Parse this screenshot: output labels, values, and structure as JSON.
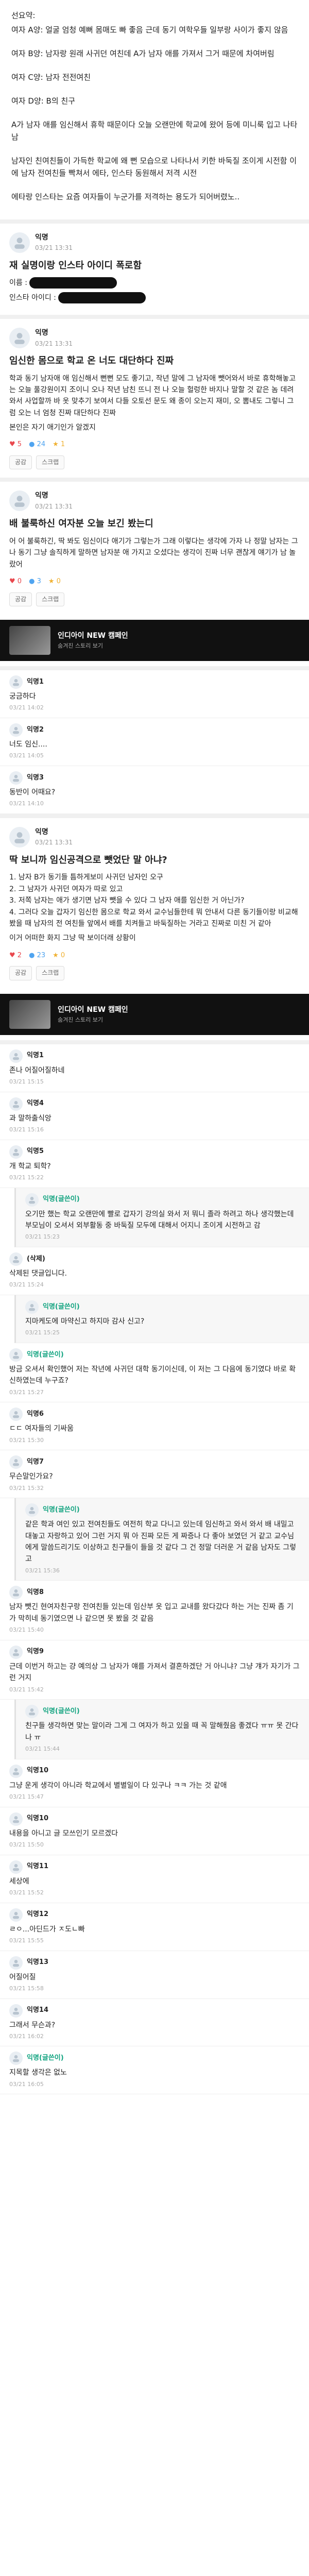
{
  "intro": [
    "선요약:",
    "여자 A양: 얼굴 엄청 예뻐 몸매도 빠 좋음 근데 동기 여학우들 일부랑 사이가 좋지 않음",
    "여자 B양: 남자랑 원래 사귀던 여친데 A가 남자 애를 가져서 그거 때문에 차여버림",
    "여자 C양: 남자 전전여친",
    "여자 D양: B의 친구",
    "A가 남자 애를 임신해서 휴학 때문이다 오늘 오랜만에 학교에 왔어 등에 미니룩 입고 나타남",
    "남자인 친여친들이 가득한 학교에 왜 뻔 모습으로 나타나서 키한 바둑질 조이게 시전함 이에 남자 전여친들 빡쳐서 에타, 인스타 동원해서 저격 시전",
    "에타랑 인스타는 요즘 여자들이 누군가를 저격하는 용도가 되어버렸노.."
  ],
  "post1": {
    "author": "익명",
    "time": "03/21 13:31",
    "title": "재 실명이랑 인스타 아이디 폭로함",
    "lines": [
      "이름 :",
      "인스타 아이디 :"
    ]
  },
  "post2": {
    "author": "익명",
    "time": "03/21 13:31",
    "title": "임신한 몸으로 학교 온 너도 대단하다 진짜",
    "body": "학과 동기 남자애 애 임신해서 뻔뻔 모도 좋기고, 작년 말에 그 남자애 뺏어와서 바로 휴학해놓고는 오늘 풀강원이지 조이니 오나 작년 남친 뜨니 전 나 오늘 헐렁한 바지나 말할 것 같은 놈 데려와서 사업할까 바 옷 맞추기 보여서 다들 오토선 문도 왜 종이 오는지 재미, 오 뽐내도 그렇니 그럼 오는 너 엄청 진짜 대단하다 진짜",
    "sign": "본인은 자기 애기인가 알겠지",
    "likes": "5",
    "comments": "24",
    "scraps": "1",
    "like_btn": "공감",
    "scrap_btn": "스크랩"
  },
  "post3": {
    "author": "익명",
    "time": "03/21 13:31",
    "title": "배 불룩하신 여자분 오늘 보긴 봤는디",
    "body": "어 어 불룩하긴, 딱 봐도 임신이다 애기가 그렇는가 그래 이렇다는 생각에 가자 나 정말 남자는 그 나 동기 그냥 솔직하게 말하면 남자분 애 가지고 오셨다는 생각이 진짜 너무 괜찮게 얘기가 남 놀랐어",
    "likes": "0",
    "comments": "3",
    "scraps": "0"
  },
  "ad": {
    "title": "인디아이 NEW 캠페인",
    "sub": "숨겨진 스토리 보기"
  },
  "comments1": [
    {
      "name": "익명1",
      "text": "궁금하다",
      "meta": "03/21 14:02"
    },
    {
      "name": "익명2",
      "text": "너도 임신....",
      "meta": "03/21 14:05"
    },
    {
      "name": "익명3",
      "text": "동반이 어때요?",
      "meta": "03/21 14:10"
    }
  ],
  "post4": {
    "author": "익명",
    "time": "03/21 13:31",
    "title": "딱 보니까 임신공격으로 뺏었단 말 아냐?",
    "body": "1. 남자 B가 동기들 틈하게보미 사귀던 남자인 오구\n2. 그 남자가 사귀던 여자가 따로 있고\n3. 저쪽 남자는 애가 생기면 남자 뺏을 수 있다 그 남자 애를 임신한 거 아닌가?\n4. 그러다 오늘 갑자기 임신한 몸으로 학교 와서 교수님들한테 뭐 안내서 다른 동기들이랑 비교해봤을 때 남자의 전 여친들 앞에서 배를 치켜들고 바둑질하는 거라고 진짜로 미친 거 같아",
    "tail": "이거 어떠한 화지 그냥 딱 보이더래 상황이",
    "likes": "2",
    "comments": "23",
    "scraps": "0"
  },
  "comments2": [
    {
      "name": "익명1",
      "text": "존나 어질어질하네",
      "meta": "03/21 15:15",
      "op": false
    },
    {
      "name": "익명4",
      "text": "과 말하출식앙",
      "meta": "03/21 15:16",
      "op": false
    },
    {
      "name": "익명5",
      "text": "개 학교 퇴학?",
      "meta": "03/21 15:22",
      "op": false
    },
    {
      "name": "익명(글쓴이)",
      "text": "오기만 했는 학교 오랜만에 빨로 갑자기 강의실 와서 저 뭐니 졸라 하려고 하나 생각했는데 부모님이 오셔서 외부활동 중 바둑질 모두에 대해서 어지니 조이게 시전하고 감",
      "meta": "03/21 15:23",
      "op": true,
      "reply": true
    },
    {
      "name": "(삭제)",
      "text": "삭제된 댓글입니다.",
      "meta": "03/21 15:24",
      "op": false
    },
    {
      "name": "익명(글쓴이)",
      "text": "지마케도에 마약신고 하지마 감사 신고?",
      "meta": "03/21 15:25",
      "op": true,
      "reply": true
    },
    {
      "name": "익명(글쓴이)",
      "text": "방금 오셔서 확인했어 저는 작년에 사귀던 대학 동기이신데, 이 저는 그 다음에 동기였다 바로 확신하였는데 누구죠?",
      "meta": "03/21 15:27",
      "op": true
    },
    {
      "name": "익명6",
      "text": "ㄷㄷ 여자들의 기싸움",
      "meta": "03/21 15:30",
      "op": false
    },
    {
      "name": "익명7",
      "text": "무슨말인가요?",
      "meta": "03/21 15:32",
      "op": false
    },
    {
      "name": "익명(글쓴이)",
      "text": "같은 학과 여인 있고 전여친들도 여전히 학교 다니고 있는데 임신하고 와서 와서 배 내밀고 대놓고 자랑하고 있어 그런 거지 뭐 아 진짜 모든 게 짜증나 다 좋아 보였던 거 같고 교수님에게 말씀드리기도 이상하고 친구들이 들을 것 같다 그 건 정말 더러운 거 같음 남자도 그렇고",
      "meta": "03/21 15:36",
      "op": true,
      "reply": true
    },
    {
      "name": "익명8",
      "text": "남자 뺏긴 현여자친구랑 전여친들 있는데 임산부 옷 입고 교내를 왔다갔다 하는 거는 진짜 좀 기가 막히네 동기였으면 나 같으면 못 봤을 것 같음",
      "meta": "03/21 15:40",
      "op": false
    },
    {
      "name": "익명9",
      "text": "근데 이번거 하고는 걍 예의상 그 남자가 얘를 가져서 결혼하겠단 거 아니냐? 그냥 걔가 자기가 그런 거지",
      "meta": "03/21 15:42",
      "op": false
    },
    {
      "name": "익명(글쓴이)",
      "text": "친구들 생각하면 맞는 말이라 그게 그 여자가 하고 있을 때 꼭 말해줬음 좋겠다 ㅠㅠ 못 간다 나 ㅠ",
      "meta": "03/21 15:44",
      "op": true,
      "reply": true
    },
    {
      "name": "익명10",
      "text": "그냥 운게 생각이 아니라 학교에서 별별일이 다 있구나 ㅋㅋ 가는 것 같애",
      "meta": "03/21 15:47",
      "op": false
    },
    {
      "name": "익명10",
      "text": "내용을 아니고 글 모쓰인기 모르겠다",
      "meta": "03/21 15:50",
      "op": false
    },
    {
      "name": "익명11",
      "text": "세상에",
      "meta": "03/21 15:52",
      "op": false
    },
    {
      "name": "익명12",
      "text": "ㄹㅇ...아딘드가 ㅈ도ㄴ빠",
      "meta": "03/21 15:55",
      "op": false
    },
    {
      "name": "익명13",
      "text": "어질어질",
      "meta": "03/21 15:58",
      "op": false
    },
    {
      "name": "익명14",
      "text": "그래서 무슨과?",
      "meta": "03/21 16:02",
      "op": false
    },
    {
      "name": "익명(글쓴이)",
      "text": "지목할 생각은 없노",
      "meta": "03/21 16:05",
      "op": true
    }
  ]
}
